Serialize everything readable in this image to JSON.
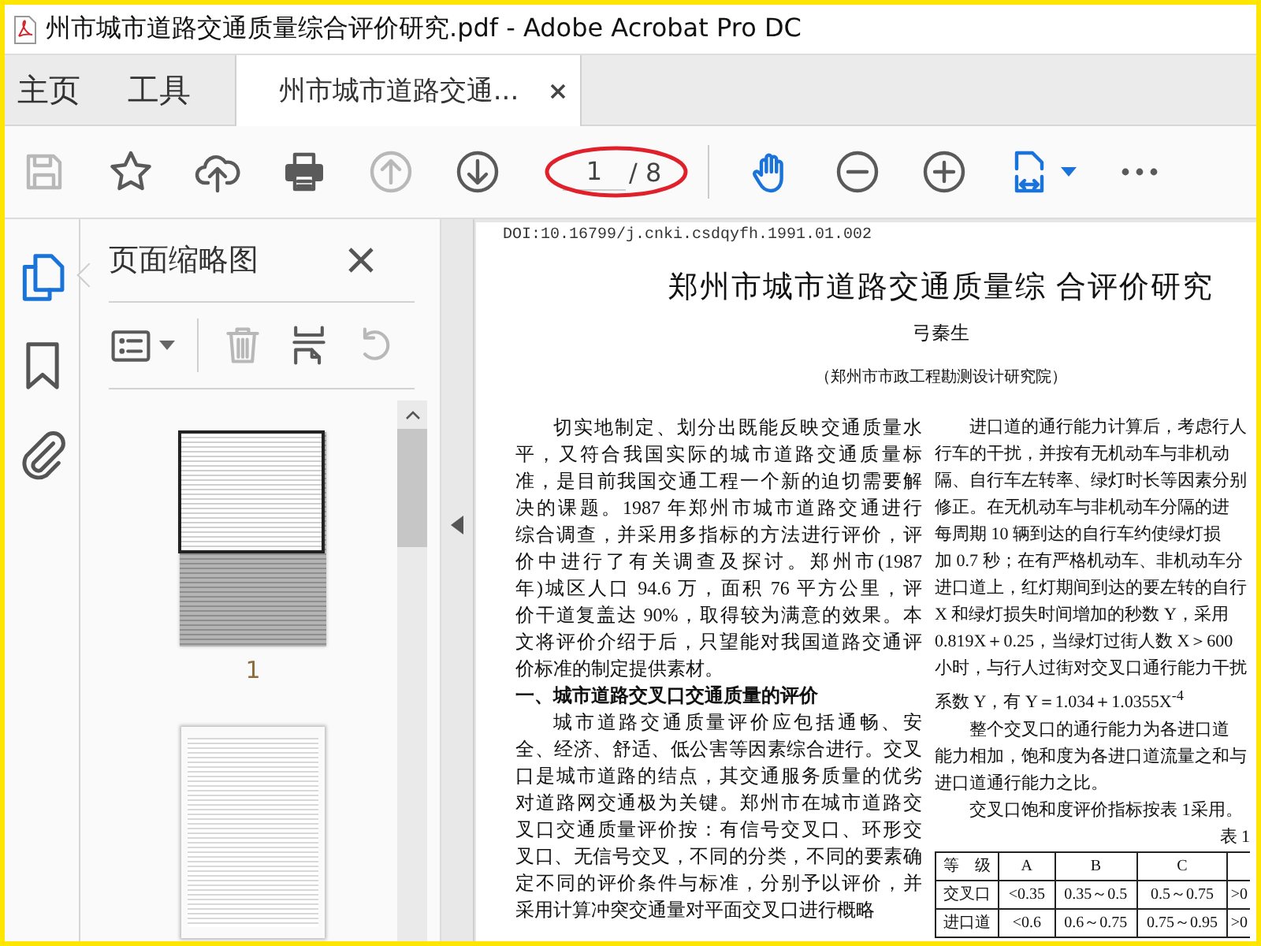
{
  "window": {
    "title": "州市城市道路交通质量综合评价研究.pdf - Adobe Acrobat Pro DC"
  },
  "tabs": [
    {
      "label": "主页",
      "kind": "nav",
      "selected": false
    },
    {
      "label": "工具",
      "kind": "nav",
      "selected": false
    },
    {
      "label": "州市城市道路交通...",
      "kind": "document",
      "selected": true
    }
  ],
  "toolbar": {
    "tools_before": [
      {
        "disabled": true
      },
      {
        "disabled": false
      },
      {
        "disabled": false
      },
      {
        "disabled": false
      },
      {
        "disabled": true
      },
      {
        "disabled": false
      }
    ],
    "page_field": {
      "value": "1",
      "total": "/ 8"
    },
    "tools_after": [
      {
        "disabled": false,
        "active": true
      },
      {
        "disabled": false,
        "active": false
      },
      {
        "disabled": false,
        "active": false
      },
      {
        "disabled": false,
        "active": true,
        "dropdown": true
      },
      {
        "disabled": false,
        "active": false
      }
    ]
  },
  "side_rail": [
    {
      "selected": true
    },
    {
      "selected": false
    },
    {
      "selected": false
    }
  ],
  "thumbnail_panel": {
    "title": "页面缩略图",
    "tools": [
      {
        "disabled": false,
        "dropdown": true
      },
      {
        "disabled": true
      },
      {
        "disabled": false
      },
      {
        "disabled": true
      }
    ],
    "pages": [
      {
        "label": "1",
        "selected": true
      },
      {
        "selected": false
      }
    ]
  },
  "document": {
    "doi": "DOI:10.16799/j.cnki.csdqyfh.1991.01.002",
    "title": "郑州市城市道路交通质量综 合评价研究",
    "author": "弓秦生",
    "affiliation": "（郑州市市政工程勘测设计研究院）",
    "columns": [
      {
        "blocks": [
          {
            "kind": "paragraph",
            "lines": [
              "切实地制定、划分出既能反映交通质量水",
              "平，又符合我国实际的城市道路交通质量标",
              "准，是目前我国交通工程一个新的迫切需要解",
              "决的课题。1987 年郑州市城市道路交通进行",
              "综合调查，并采用多指标的方法进行评价，评",
              "价中进行了有关调查及探讨。郑州市(1987",
              "年)城区人口 94.6 万，面积 76 平方公里，评",
              "价干道复盖达 90%，取得较为满意的效果。本",
              "文将评价介绍于后，只望能对我国道路交通评",
              "价标准的制定提供素材。"
            ]
          },
          {
            "kind": "heading",
            "text": "一、城市道路交叉口交通质量的评价"
          },
          {
            "kind": "paragraph",
            "lines": [
              "城市道路交通质量评价应包括通畅、安",
              "全、经济、舒适、低公害等因素综合进行。交叉",
              "口是城市道路的结点，其交通服务质量的优劣",
              "对道路网交通极为关键。郑州市在城市道路交",
              "叉口交通质量评价按：有信号交叉口、环形交",
              "叉口、无信号交叉，不同的分类，不同的要素确",
              "定不同的评价条件与标准，分别予以评价，并",
              "采用计算冲突交通量对平面交叉口进行概略"
            ]
          }
        ]
      },
      {
        "blocks": [
          {
            "kind": "paragraph",
            "lines": [
              "进口道的通行能力计算后，考虑行人",
              "行车的干扰，并按有无机动车与非机动",
              "隔、自行车左转率、绿灯时长等因素分别",
              "修正。在无机动车与非机动车分隔的进",
              "每周期 10 辆到达的自行车约使绿灯损",
              "加 0.7 秒；在有严格机动车、非机动车分",
              "进口道上，红灯期间到达的要左转的自行",
              "X 和绿灯损失时间增加的秒数 Y，采用",
              "0.819X＋0.25，当绿灯过街人数 X＞600",
              "小时，与行人过街对交叉口通行能力干扰",
              "系数 Y，有 Y＝1.034＋1.0355X$^{-4}$"
            ]
          },
          {
            "kind": "paragraph",
            "lines": [
              "整个交叉口的通行能力为各进口道",
              "能力相加，饱和度为各进口道流量之和与",
              "进口道通行能力之比。"
            ]
          },
          {
            "kind": "paragraph",
            "lines": [
              "交叉口饱和度评价指标按表 1采用。"
            ]
          },
          {
            "kind": "caption",
            "text": "表 1"
          },
          {
            "kind": "table",
            "header": [
              "等　级",
              "A",
              "B",
              "C"
            ],
            "rows": [
              [
                "交叉口",
                "<0.35",
                "0.35～0.5",
                "0.5～0.75",
                ">0"
              ],
              [
                "进口道",
                "<0.6",
                "0.6～0.75",
                "0.75～0.95",
                ">0"
              ]
            ]
          }
        ]
      }
    ]
  }
}
